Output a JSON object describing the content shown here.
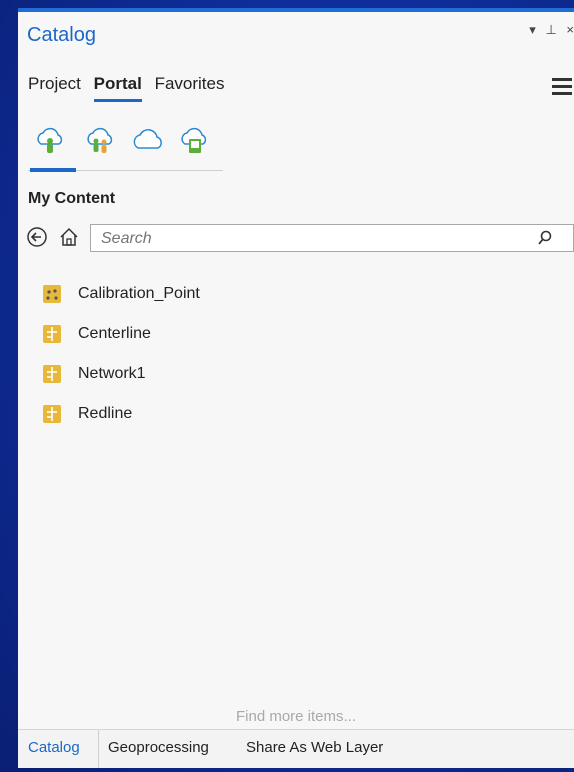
{
  "window": {
    "title": "Catalog",
    "controls": {
      "dropdown_label": "▾",
      "pin_label": "⊥",
      "close_label": "×"
    }
  },
  "tabs": [
    {
      "label": "Project",
      "active": false
    },
    {
      "label": "Portal",
      "active": true
    },
    {
      "label": "Favorites",
      "active": false
    }
  ],
  "portal_icons": [
    "my-content-cloud-icon",
    "groups-cloud-icon",
    "all-portal-cloud-icon",
    "living-atlas-cloud-icon"
  ],
  "section_title": "My Content",
  "search": {
    "placeholder": "Search",
    "value": ""
  },
  "items": [
    {
      "label": "Calibration_Point",
      "icon": "point-feature-class-icon"
    },
    {
      "label": "Centerline",
      "icon": "feature-layer-icon"
    },
    {
      "label": "Network1",
      "icon": "feature-layer-icon"
    },
    {
      "label": "Redline",
      "icon": "feature-layer-icon"
    }
  ],
  "footer_link": "Find more items...",
  "bottom_tabs": [
    {
      "label": "Catalog",
      "active": true
    },
    {
      "label": "Geoprocessing",
      "active": false
    },
    {
      "label": "Share As Web Layer",
      "active": false
    }
  ],
  "colors": {
    "accent": "#1c68c9",
    "item_icon": "#e8b83a"
  }
}
